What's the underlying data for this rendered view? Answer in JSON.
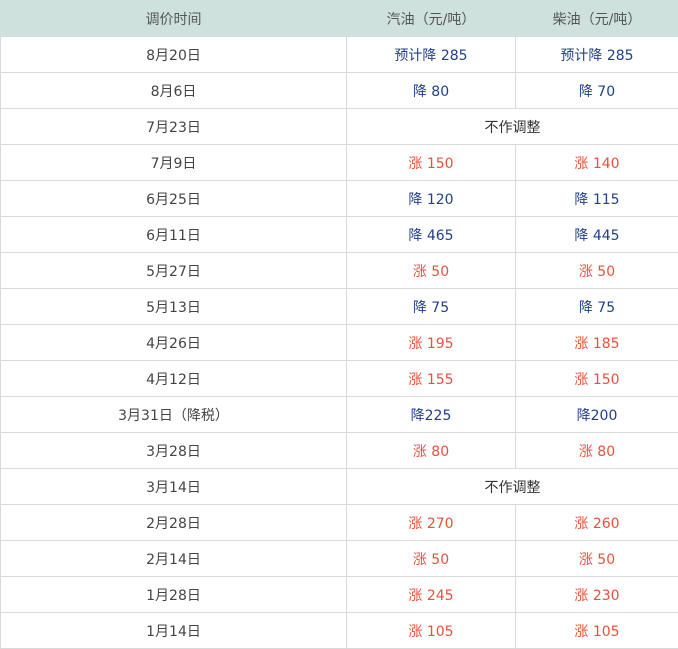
{
  "table": {
    "headers": [
      "调价时间",
      "汽油（元/吨）",
      "柴油（元/吨）"
    ],
    "rows": [
      {
        "date": "8月20日",
        "gasoline": "预计降 285",
        "diesel": "预计降 285",
        "type": "down"
      },
      {
        "date": "8月6日",
        "gasoline": "降 80",
        "diesel": "降 70",
        "type": "down"
      },
      {
        "date": "7月23日",
        "merged": "不作调整",
        "type": "flat"
      },
      {
        "date": "7月9日",
        "gasoline": "涨 150",
        "diesel": "涨 140",
        "type": "up"
      },
      {
        "date": "6月25日",
        "gasoline": "降 120",
        "diesel": "降 115",
        "type": "down"
      },
      {
        "date": "6月11日",
        "gasoline": "降 465",
        "diesel": "降 445",
        "type": "down"
      },
      {
        "date": "5月27日",
        "gasoline": "涨 50",
        "diesel": "涨 50",
        "type": "up"
      },
      {
        "date": "5月13日",
        "gasoline": "降 75",
        "diesel": "降 75",
        "type": "down"
      },
      {
        "date": "4月26日",
        "gasoline": "涨 195",
        "diesel": "涨 185",
        "type": "up"
      },
      {
        "date": "4月12日",
        "gasoline": "涨 155",
        "diesel": "涨 150",
        "type": "up"
      },
      {
        "date": "3月31日（降税）",
        "gasoline": "降225",
        "diesel": "降200",
        "type": "down"
      },
      {
        "date": "3月28日",
        "gasoline": "涨 80",
        "diesel": "涨 80",
        "type": "up"
      },
      {
        "date": "3月14日",
        "merged": "不作调整",
        "type": "flat"
      },
      {
        "date": "2月28日",
        "gasoline": "涨 270",
        "diesel": "涨 260",
        "type": "up"
      },
      {
        "date": "2月14日",
        "gasoline": "涨 50",
        "diesel": "涨 50",
        "type": "up"
      },
      {
        "date": "1月28日",
        "gasoline": "涨 245",
        "diesel": "涨 230",
        "type": "up"
      },
      {
        "date": "1月14日",
        "gasoline": "涨 105",
        "diesel": "涨 105",
        "type": "up"
      }
    ]
  },
  "colors": {
    "up": "#e8513a",
    "down": "#1f3f8a",
    "header_bg": "#cfe1dc"
  }
}
